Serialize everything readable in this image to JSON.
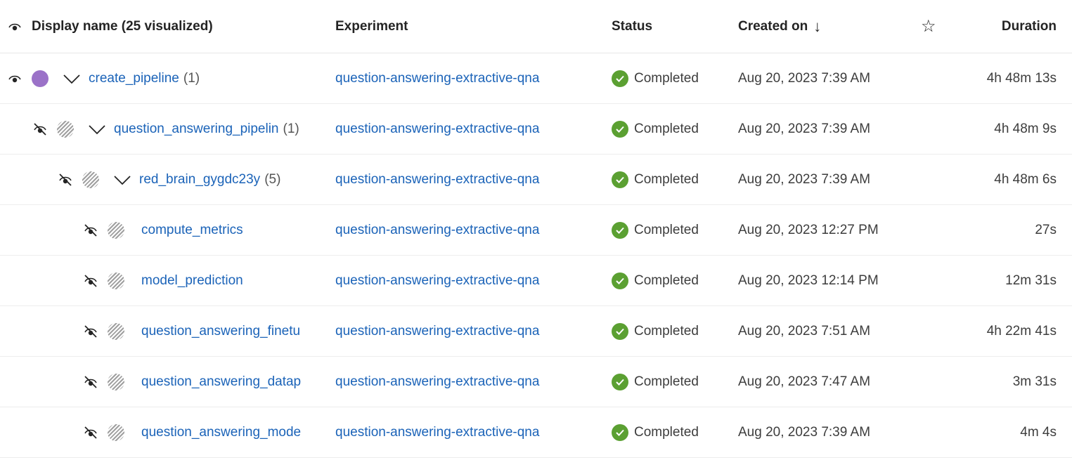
{
  "header": {
    "display_name": "Display name (25 visualized)",
    "experiment": "Experiment",
    "status": "Status",
    "created_on": "Created on",
    "sort_arrow": "↓",
    "star": "☆",
    "duration": "Duration"
  },
  "rows": [
    {
      "name": "create_pipeline",
      "count": "(1)",
      "experiment": "question-answering-extractive-qna",
      "status": "Completed",
      "created": "Aug 20, 2023 7:39 AM",
      "duration": "4h 48m 13s"
    },
    {
      "name": "question_answering_pipelin",
      "count": "(1)",
      "experiment": "question-answering-extractive-qna",
      "status": "Completed",
      "created": "Aug 20, 2023 7:39 AM",
      "duration": "4h 48m 9s"
    },
    {
      "name": "red_brain_gygdc23y",
      "count": "(5)",
      "experiment": "question-answering-extractive-qna",
      "status": "Completed",
      "created": "Aug 20, 2023 7:39 AM",
      "duration": "4h 48m 6s"
    },
    {
      "name": "compute_metrics",
      "experiment": "question-answering-extractive-qna",
      "status": "Completed",
      "created": "Aug 20, 2023 12:27 PM",
      "duration": "27s"
    },
    {
      "name": "model_prediction",
      "experiment": "question-answering-extractive-qna",
      "status": "Completed",
      "created": "Aug 20, 2023 12:14 PM",
      "duration": "12m 31s"
    },
    {
      "name": "question_answering_finetu",
      "experiment": "question-answering-extractive-qna",
      "status": "Completed",
      "created": "Aug 20, 2023 7:51 AM",
      "duration": "4h 22m 41s"
    },
    {
      "name": "question_answering_datap",
      "experiment": "question-answering-extractive-qna",
      "status": "Completed",
      "created": "Aug 20, 2023 7:47 AM",
      "duration": "3m 31s"
    },
    {
      "name": "question_answering_mode",
      "experiment": "question-answering-extractive-qna",
      "status": "Completed",
      "created": "Aug 20, 2023 7:39 AM",
      "duration": "4m 4s"
    }
  ],
  "colors": {
    "link": "#1b63b8",
    "success": "#5ba032",
    "visualized_dot": "#9b72c8"
  }
}
